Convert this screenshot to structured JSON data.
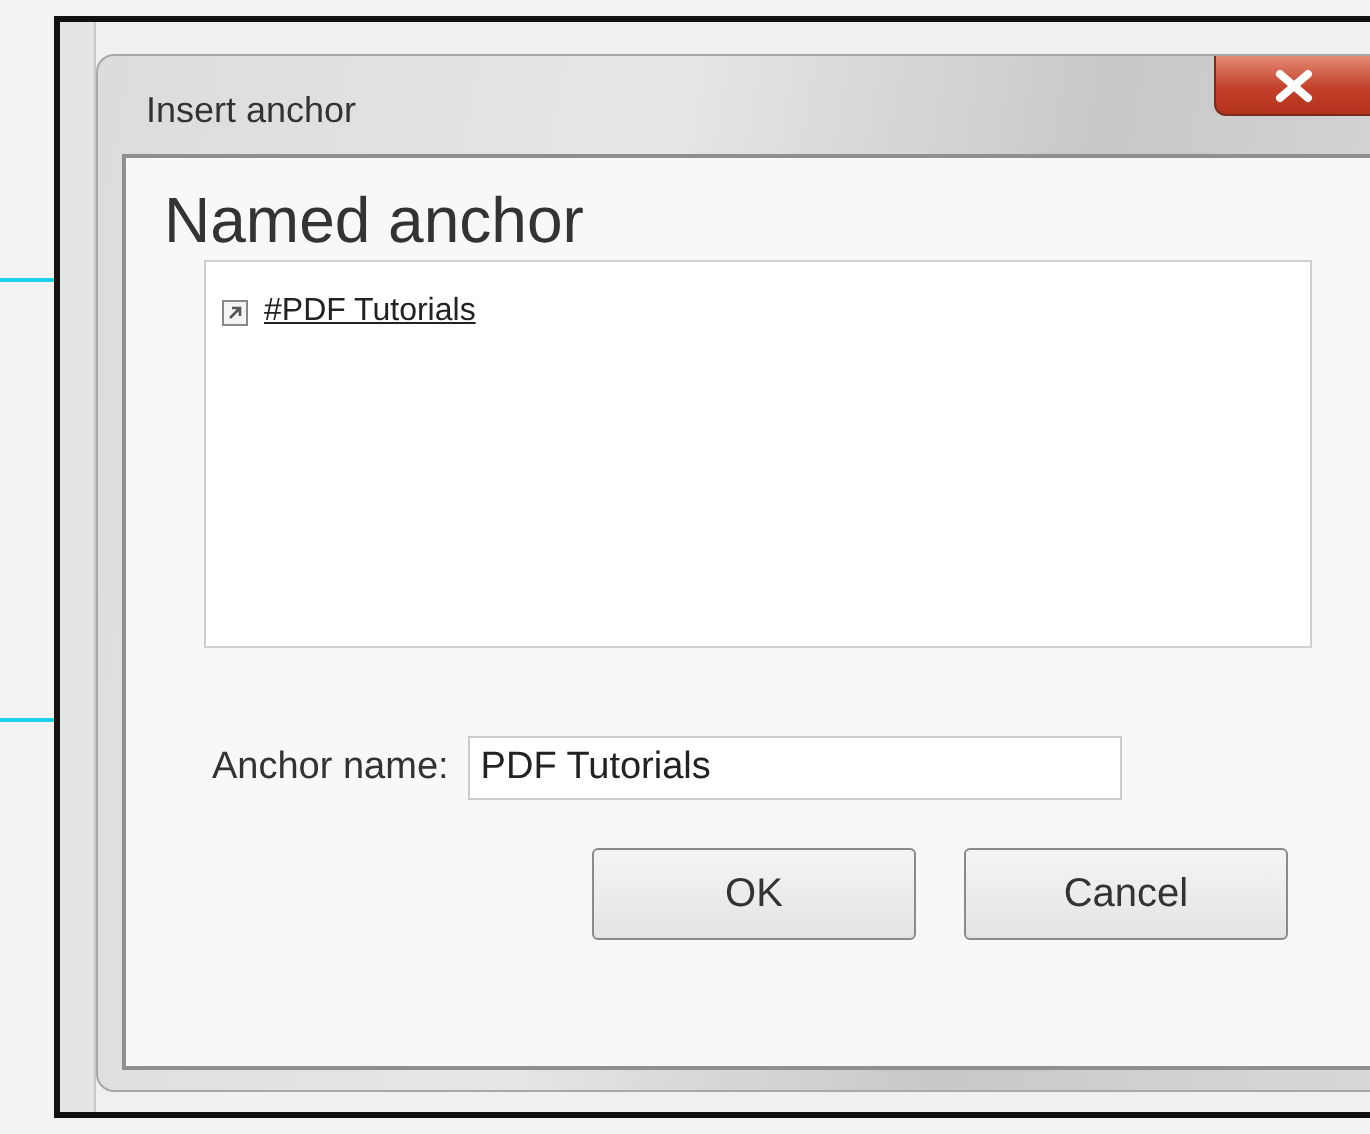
{
  "window": {
    "title": "Insert anchor"
  },
  "heading": "Named anchor",
  "anchors": [
    {
      "label": "#PDF Tutorials"
    }
  ],
  "anchor_name": {
    "label": "Anchor name:",
    "value": "PDF Tutorials"
  },
  "buttons": [
    "OK",
    "Cancel"
  ]
}
